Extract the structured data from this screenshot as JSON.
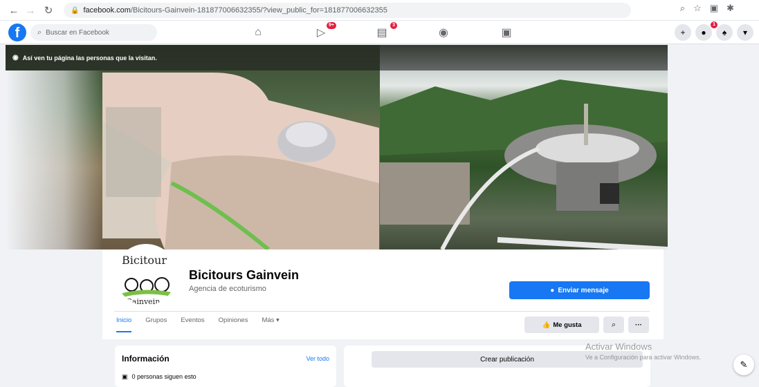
{
  "browser": {
    "url_host": "facebook.com",
    "url_path": "/Bicitours-Gainvein-181877006632355/?view_public_for=181877006632355"
  },
  "fb_header": {
    "logo": "f",
    "search_placeholder": "Buscar en Facebook",
    "watch_badge": "9+",
    "marketplace_badge": "3",
    "messenger_badge": "1"
  },
  "cover": {
    "privacy_notice": "Así ven tu página las personas que la visitan."
  },
  "profile": {
    "avatar_text_top": "Bicitour",
    "avatar_text_bottom": "Gainvein",
    "name": "Bicitours Gainvein",
    "category": "Agencia de ecoturismo",
    "send_message_label": "Enviar mensaje"
  },
  "tabs": [
    "Inicio",
    "Grupos",
    "Eventos",
    "Opiniones",
    "Más"
  ],
  "actions": {
    "like_label": "Me gusta",
    "more_label": "···"
  },
  "info_card": {
    "title": "Información",
    "see_all": "Ver todo",
    "followers_text": "0 personas siguen esto"
  },
  "create_post": {
    "label": "Crear publicación"
  },
  "windows_watermark": {
    "line1": "Activar Windows",
    "line2": "Ve a Configuración para activar Windows."
  },
  "colors": {
    "accent": "#1877f2",
    "badge": "#e41e3f"
  }
}
